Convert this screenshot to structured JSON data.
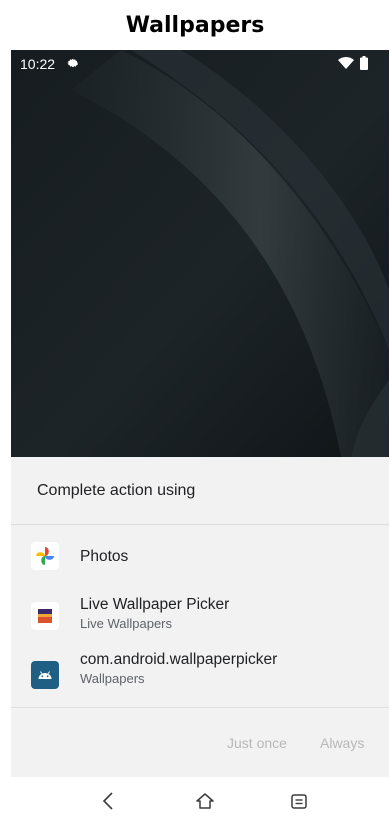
{
  "caption": "Wallpapers",
  "status_bar": {
    "time": "10:22"
  },
  "dialog": {
    "title": "Complete action using",
    "apps": [
      {
        "name": "Photos",
        "subtitle": ""
      },
      {
        "name": "Live Wallpaper Picker",
        "subtitle": "Live Wallpapers"
      },
      {
        "name": "com.android.wallpaperpicker",
        "subtitle": "Wallpapers"
      }
    ],
    "buttons": {
      "just_once": "Just once",
      "always": "Always"
    }
  },
  "nav_bar": {
    "icons": [
      "back-icon",
      "home-icon",
      "recents-icon"
    ]
  },
  "colors": {
    "dialog_bg": "#f2f2f2",
    "wallpaper_bg": "#151b1f",
    "disabled_button": "#b8b8b8",
    "android_icon_bg": "#1f5f84"
  }
}
